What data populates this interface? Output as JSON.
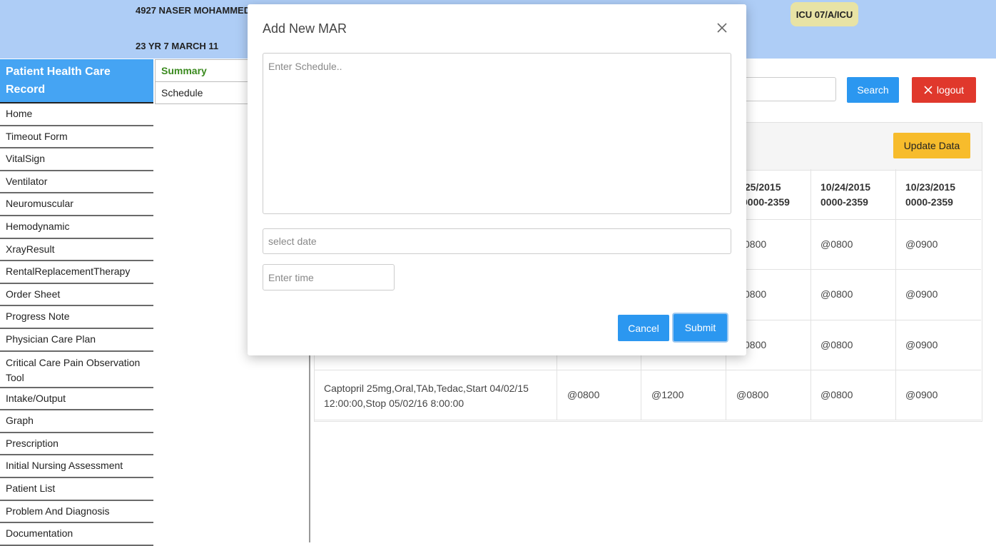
{
  "header": {
    "patient_name": "4927 NASER MOHAMMED",
    "patient_age": "23 YR 7 MARCH 11",
    "ward": "ICU 07/A/ICU"
  },
  "sidebar": {
    "title": "Patient Health Care Record",
    "items": [
      "Home",
      "Timeout Form",
      "VitalSign",
      "Ventilator",
      "Neuromuscular",
      "Hemodynamic",
      "XrayResult",
      "RentalReplacementTherapy",
      "Order Sheet",
      "Progress Note",
      "Physician Care Plan",
      "Critical Care Pain Observation Tool",
      "Intake/Output",
      "Graph",
      "Prescription",
      "Initial Nursing Assessment",
      "Patient List",
      "Problem And Diagnosis",
      "Documentation"
    ]
  },
  "subnav": {
    "items": [
      "Summary",
      "Schedule"
    ]
  },
  "toolbar": {
    "search_label": "Search",
    "logout_label": "logout",
    "update_label": "Update Data"
  },
  "table": {
    "headers": [
      [
        "",
        "/25/2015",
        "0000-2359"
      ],
      [
        "",
        "10/24/2015",
        "0000-2359"
      ],
      [
        "",
        "10/23/2015",
        "0000-2359"
      ]
    ],
    "rows": [
      {
        "drug": "",
        "cells": [
          "",
          "",
          "0800",
          "@0800",
          "@0900"
        ]
      },
      {
        "drug": "",
        "cells": [
          "",
          "",
          "0800",
          "@0800",
          "@0900"
        ]
      },
      {
        "drug": "",
        "cells": [
          "",
          "",
          "0800",
          "@0800",
          "@0900"
        ]
      },
      {
        "drug": "Captopril 25mg,Oral,TAb,Tedac,Start 04/02/15 12:00:00,Stop 05/02/16 8:00:00",
        "cells": [
          "@0800",
          "@1200",
          "@0800",
          "@0800",
          "@0900"
        ]
      }
    ]
  },
  "modal": {
    "title": "Add New MAR",
    "schedule_placeholder": "Enter Schedule..",
    "date_placeholder": "select date",
    "time_placeholder": "Enter time",
    "cancel_label": "Cancel",
    "submit_label": "Submit"
  }
}
